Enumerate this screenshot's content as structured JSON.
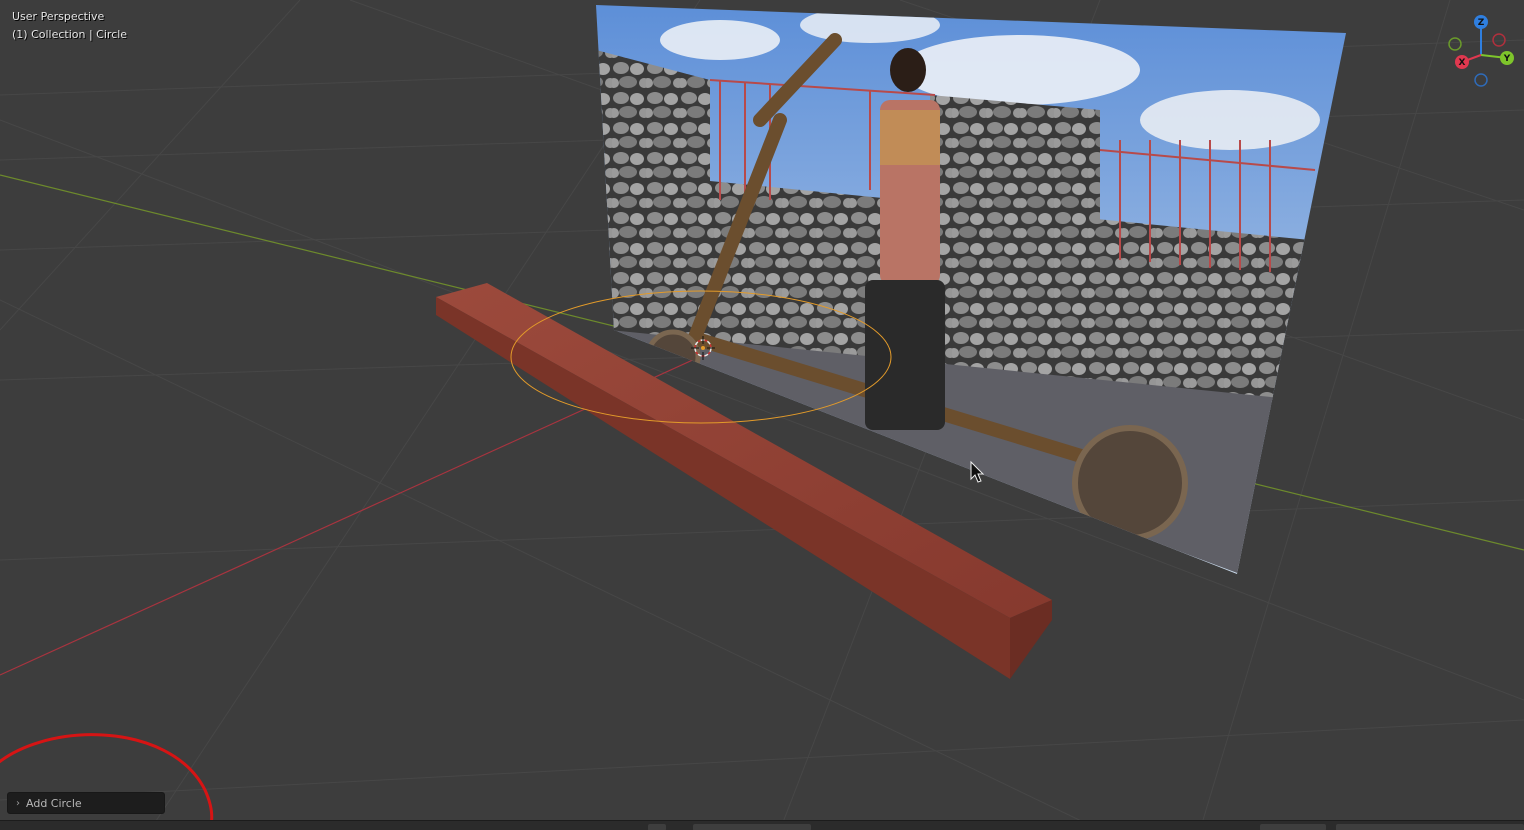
{
  "viewport": {
    "view_name": "User Perspective",
    "collection_info": "(1) Collection | Circle",
    "background_color": "#3d3d3d"
  },
  "operator_panel": {
    "label": "Add Circle",
    "icon": "chevron-right-icon"
  },
  "gizmo": {
    "axes": {
      "z": {
        "label": "Z",
        "color": "#2f7fe0"
      },
      "y": {
        "label": "Y",
        "color": "#7ec52b"
      },
      "x": {
        "label": "X",
        "color": "#e0384f"
      }
    }
  },
  "scene": {
    "x_axis_color": "#a8343f",
    "y_axis_color": "#6d8a2c",
    "selected_outline_color": "#e39b2a",
    "beam_color": "#8c3f32",
    "annotation_color": "#d61414"
  },
  "photo": {
    "description_icon": "image-icon"
  }
}
